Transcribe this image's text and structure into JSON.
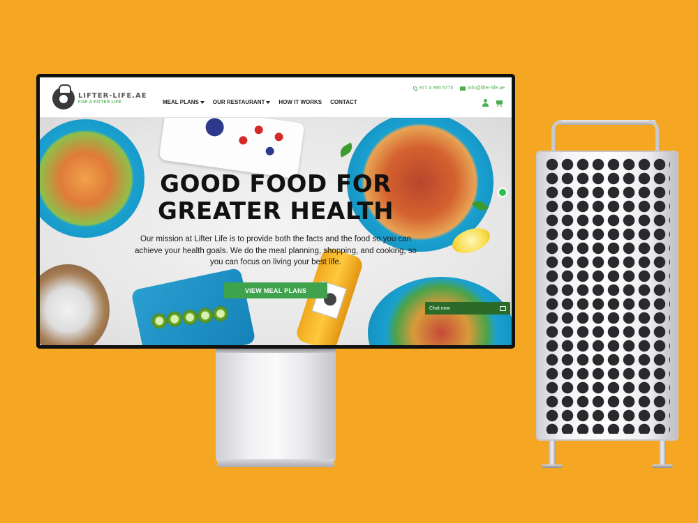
{
  "site": {
    "logo": {
      "name": "LIFTER-LIFE.AE",
      "tagline": "FOR A FITTER LIFE"
    },
    "nav": [
      {
        "label": "MEAL PLANS",
        "dropdown": true
      },
      {
        "label": "OUR RESTAURANT",
        "dropdown": true
      },
      {
        "label": "HOW IT WORKS",
        "dropdown": false
      },
      {
        "label": "CONTACT",
        "dropdown": false
      }
    ],
    "contact": {
      "phone": "971 4 395 5775",
      "email": "info@lifter-life.ae"
    },
    "hero": {
      "title_line1": "GOOD FOOD FOR",
      "title_line2": "GREATER HEALTH",
      "text": "Our mission at Lifter Life is to provide both the facts and the food so you can achieve your health goals. We do the meal planning, shopping, and cooking, so you can focus on living your best life.",
      "cta": "VIEW MEAL PLANS"
    },
    "chat": {
      "label": "Chat now"
    },
    "colors": {
      "accent": "#3fa34d",
      "background": "#F5A623",
      "chat": "#2a6b2a"
    }
  },
  "icons": [
    "phone-icon",
    "mail-icon",
    "user-icon",
    "cart-icon",
    "whatsapp-icon",
    "chat-icon"
  ]
}
